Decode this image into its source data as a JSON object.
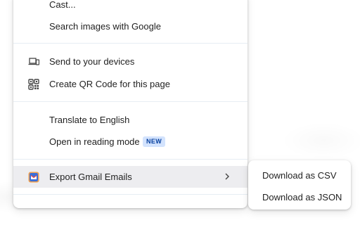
{
  "context_menu": {
    "items": [
      {
        "label": "Cast..."
      },
      {
        "label": "Search images with Google"
      },
      {
        "label": "Send to your devices",
        "icon": "devices-icon"
      },
      {
        "label": "Create QR Code for this page",
        "icon": "qr-code-icon"
      },
      {
        "label": "Translate to English"
      },
      {
        "label": "Open in reading mode",
        "badge": "NEW"
      },
      {
        "label": "Export Gmail Emails",
        "icon": "extension-icon",
        "has_submenu": true
      }
    ]
  },
  "submenu": {
    "items": [
      {
        "label": "Download as CSV"
      },
      {
        "label": "Download as JSON"
      }
    ]
  },
  "colors": {
    "highlight": "#ededf0",
    "badge_bg": "#d3e3fd",
    "badge_text": "#0842a0",
    "separator": "#e7edf3"
  }
}
